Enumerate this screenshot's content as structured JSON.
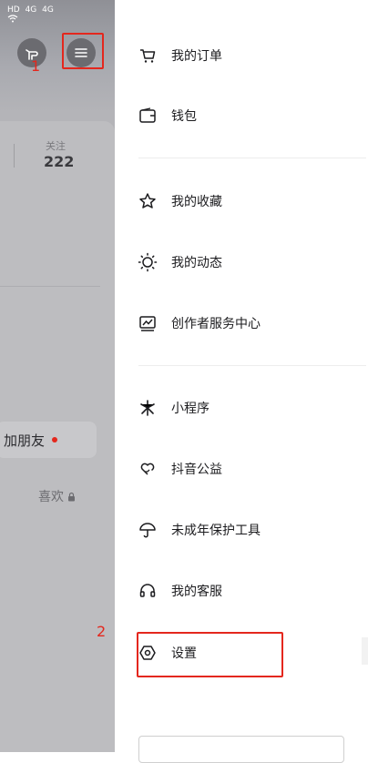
{
  "status_bar": {
    "text": [
      "HD",
      "4G",
      "4G",
      "wifi"
    ]
  },
  "profile": {
    "follow_label": "关注",
    "follow_count": "222",
    "add_friend": "加朋友",
    "likes": "喜欢"
  },
  "annotations": {
    "step1": "1",
    "step2": "2"
  },
  "menu": {
    "orders": "我的订单",
    "wallet": "钱包",
    "favorites": "我的收藏",
    "activity": "我的动态",
    "creator": "创作者服务中心",
    "mini_programs": "小程序",
    "charity": "抖音公益",
    "minor_protection": "未成年保护工具",
    "customer_service": "我的客服",
    "settings": "设置"
  },
  "icons": [
    "hand-icon",
    "menu-icon",
    "cart-icon",
    "wallet-icon",
    "star-icon",
    "activity-icon",
    "chart-icon",
    "sparkle-icon",
    "heart-hand-icon",
    "umbrella-icon",
    "headset-icon",
    "hexagon-settings-icon",
    "lock-icon"
  ],
  "colors": {
    "highlight": "#e4271d",
    "drawer_bg": "#ffffff",
    "text": "#1c1c1f"
  }
}
